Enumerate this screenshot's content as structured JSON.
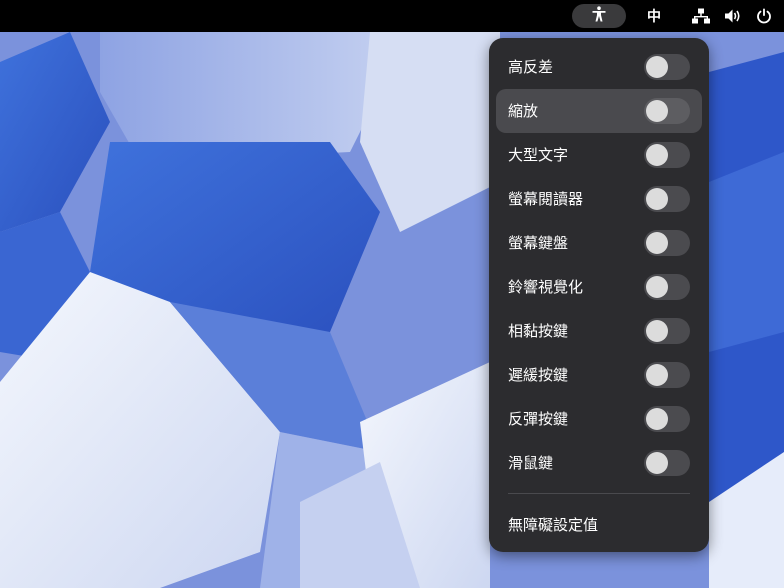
{
  "topbar": {
    "accessibility_icon": "accessibility-icon",
    "input_method_label": "中",
    "status_icons": [
      "network-wired-icon",
      "volume-icon",
      "power-icon"
    ]
  },
  "menu": {
    "items": [
      {
        "label": "高反差",
        "enabled": false
      },
      {
        "label": "縮放",
        "enabled": false
      },
      {
        "label": "大型文字",
        "enabled": false
      },
      {
        "label": "螢幕閱讀器",
        "enabled": false
      },
      {
        "label": "螢幕鍵盤",
        "enabled": false
      },
      {
        "label": "鈴響視覺化",
        "enabled": false
      },
      {
        "label": "相黏按鍵",
        "enabled": false
      },
      {
        "label": "遲緩按鍵",
        "enabled": false
      },
      {
        "label": "反彈按鍵",
        "enabled": false
      },
      {
        "label": "滑鼠鍵",
        "enabled": false
      }
    ],
    "settings_label": "無障礙設定值"
  }
}
